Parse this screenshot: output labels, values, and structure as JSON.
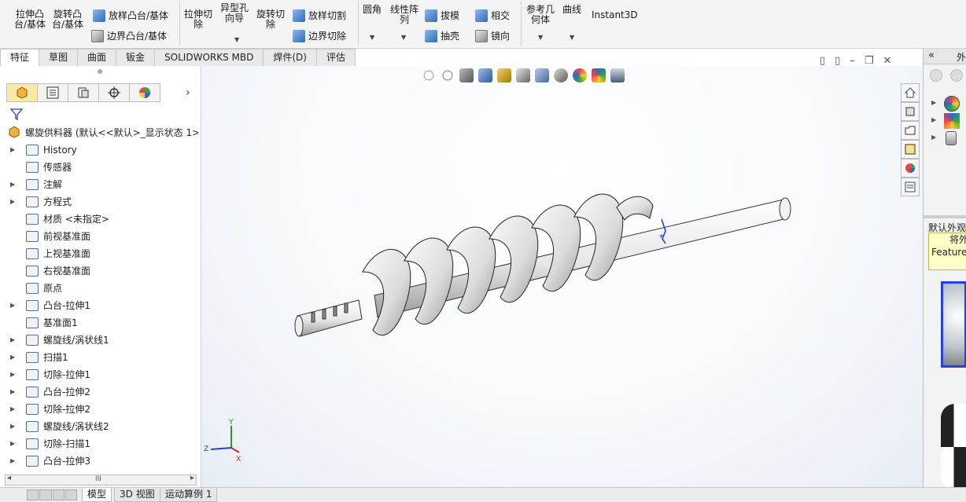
{
  "ribbon": {
    "extrude_boss": "拉伸凸\n台/基体",
    "revolve_boss": "旋转凸\n台/基体",
    "loft_boss": "放样凸台/基体",
    "boundary_boss": "边界凸台/基体",
    "extrude_cut": "拉伸切\n除",
    "hole_wizard": "异型孔\n向导",
    "revolve_cut": "旋转切\n除",
    "loft_cut": "放样切割",
    "boundary_cut": "边界切除",
    "fillet": "圆角",
    "linear_pattern": "线性阵\n列",
    "draft": "拔模",
    "shell": "抽壳",
    "intersect": "相交",
    "mirror": "镜向",
    "reference_geometry": "参考几\n何体",
    "curves": "曲线",
    "instant3d": "Instant3D"
  },
  "tabs": [
    "特征",
    "草图",
    "曲面",
    "钣金",
    "SOLIDWORKS MBD",
    "焊件(D)",
    "评估"
  ],
  "tree": {
    "root": "螺旋供料器 (默认<<默认>_显示状态 1>",
    "items": [
      {
        "label": "History",
        "arrow": true
      },
      {
        "label": "传感器",
        "arrow": false
      },
      {
        "label": "注解",
        "arrow": true
      },
      {
        "label": "方程式",
        "arrow": true
      },
      {
        "label": "材质 <未指定>",
        "arrow": false
      },
      {
        "label": "前视基准面",
        "arrow": false
      },
      {
        "label": "上视基准面",
        "arrow": false
      },
      {
        "label": "右视基准面",
        "arrow": false
      },
      {
        "label": "原点",
        "arrow": false
      },
      {
        "label": "凸台-拉伸1",
        "arrow": true
      },
      {
        "label": "基准面1",
        "arrow": false
      },
      {
        "label": "螺旋线/涡状线1",
        "arrow": true
      },
      {
        "label": "扫描1",
        "arrow": true
      },
      {
        "label": "切除-拉伸1",
        "arrow": true
      },
      {
        "label": "凸台-拉伸2",
        "arrow": true
      },
      {
        "label": "切除-拉伸2",
        "arrow": true
      },
      {
        "label": "螺旋线/涡状线2",
        "arrow": true
      },
      {
        "label": "切除-扫描1",
        "arrow": true
      },
      {
        "label": "凸台-拉伸3",
        "arrow": true
      }
    ]
  },
  "triad": {
    "x": "X",
    "y": "Y",
    "z": "Z"
  },
  "taskpane": {
    "collapse": "«",
    "title": "外",
    "section": "默认外观",
    "tip_line1": "将外",
    "tip_line2": "Featurel"
  },
  "bottom_tabs": [
    "模型",
    "3D 视图",
    "运动算例 1"
  ],
  "scroll_label": "III"
}
